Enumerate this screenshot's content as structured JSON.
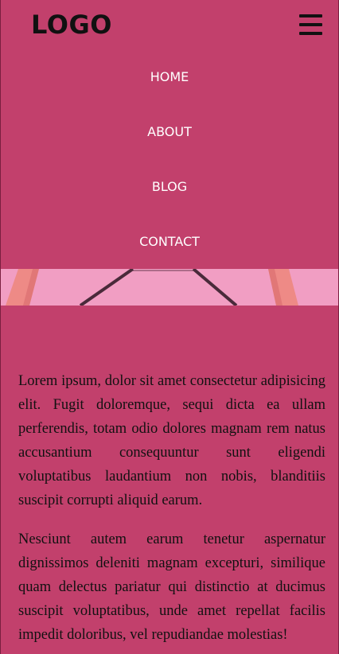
{
  "header": {
    "logo": "LOGO",
    "menu_icon": "hamburger-menu-icon"
  },
  "nav": {
    "items": [
      {
        "label": "HOME"
      },
      {
        "label": "ABOUT"
      },
      {
        "label": "BLOG"
      },
      {
        "label": "CONTACT"
      }
    ]
  },
  "hero": {
    "image": "pink-chair-legs-photo"
  },
  "main": {
    "paragraphs": [
      "Lorem ipsum, dolor sit amet consectetur adipisicing elit. Fugit doloremque, sequi dicta ea ullam perferendis, totam odio dolores magnam rem natus accusantium consequuntur sunt eligendi voluptatibus laudantium non nobis, blanditiis suscipit corrupti aliquid earum.",
      "Nesciunt autem earum tenetur aspernatur dignissimos deleniti magnam excepturi, similique quam delectus pariatur qui distinctio at ducimus suscipit voluptatibus, unde amet repellat facilis impedit doloribus, vel repudiandae molestias!"
    ]
  },
  "colors": {
    "background": "#c2406c",
    "text": "#111111",
    "nav_text": "#ffffff",
    "hero_wall": "#f09ac0"
  }
}
